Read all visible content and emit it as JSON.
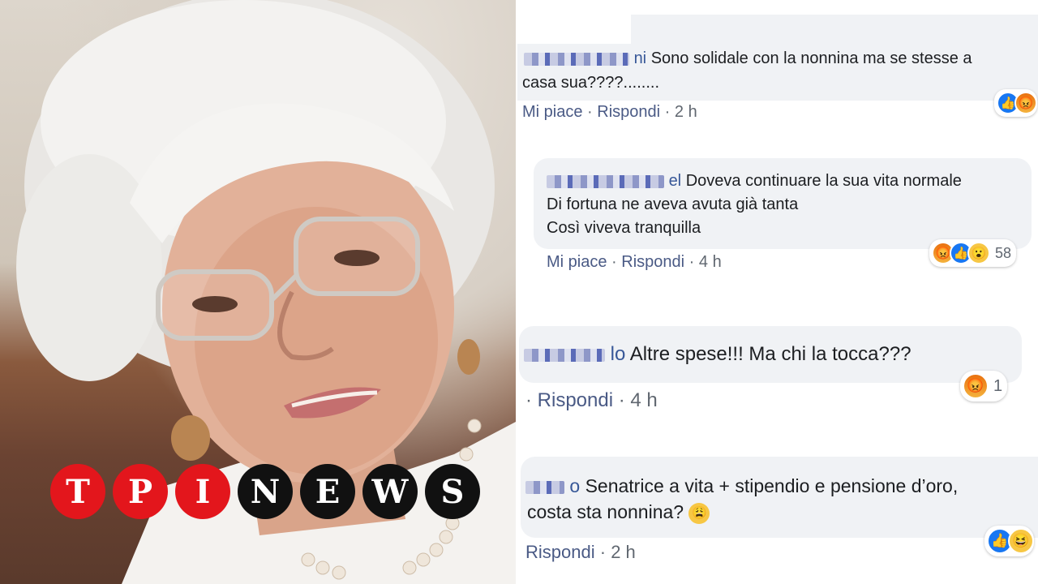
{
  "brand": {
    "letters": [
      "T",
      "P",
      "I",
      "N",
      "E",
      "W",
      "S"
    ],
    "red": "#e3161c",
    "dark": "#111111"
  },
  "comments": [
    {
      "name": "ni",
      "text_line1": "Sono solidale con la nonnina ma se stesse a",
      "text_line2": "casa sua????........",
      "actions": {
        "like": "Mi piace",
        "sep": "·",
        "reply": "Rispondi",
        "time": "2 h"
      },
      "reactions": [
        "like-icon",
        "angry-icon"
      ],
      "count": ""
    },
    {
      "name": "el",
      "text_line1": "Doveva continuare la sua vita normale",
      "text_line2": "Di fortuna ne aveva avuta già tanta",
      "text_line3": "Così viveva tranquilla",
      "actions": {
        "like": "Mi piace",
        "sep": "·",
        "reply": "Rispondi",
        "time": "4 h"
      },
      "reactions": [
        "angry-icon",
        "like-icon",
        "wow-icon"
      ],
      "count": "58"
    },
    {
      "name": "lo",
      "text_line1": "Altre spese!!! Ma chi la tocca???",
      "actions": {
        "reply": "Rispondi",
        "time": "4 h"
      },
      "reactions": [
        "angry-icon"
      ],
      "count": "1"
    },
    {
      "name": "o",
      "text_line1": "Senatrice a vita + stipendio e pensione d’oro,",
      "text_line2": "costa sta nonnina?",
      "actions": {
        "reply": "Rispondi",
        "time": "2 h"
      },
      "reactions": [
        "like-icon",
        "haha-icon"
      ],
      "count": ""
    }
  ]
}
